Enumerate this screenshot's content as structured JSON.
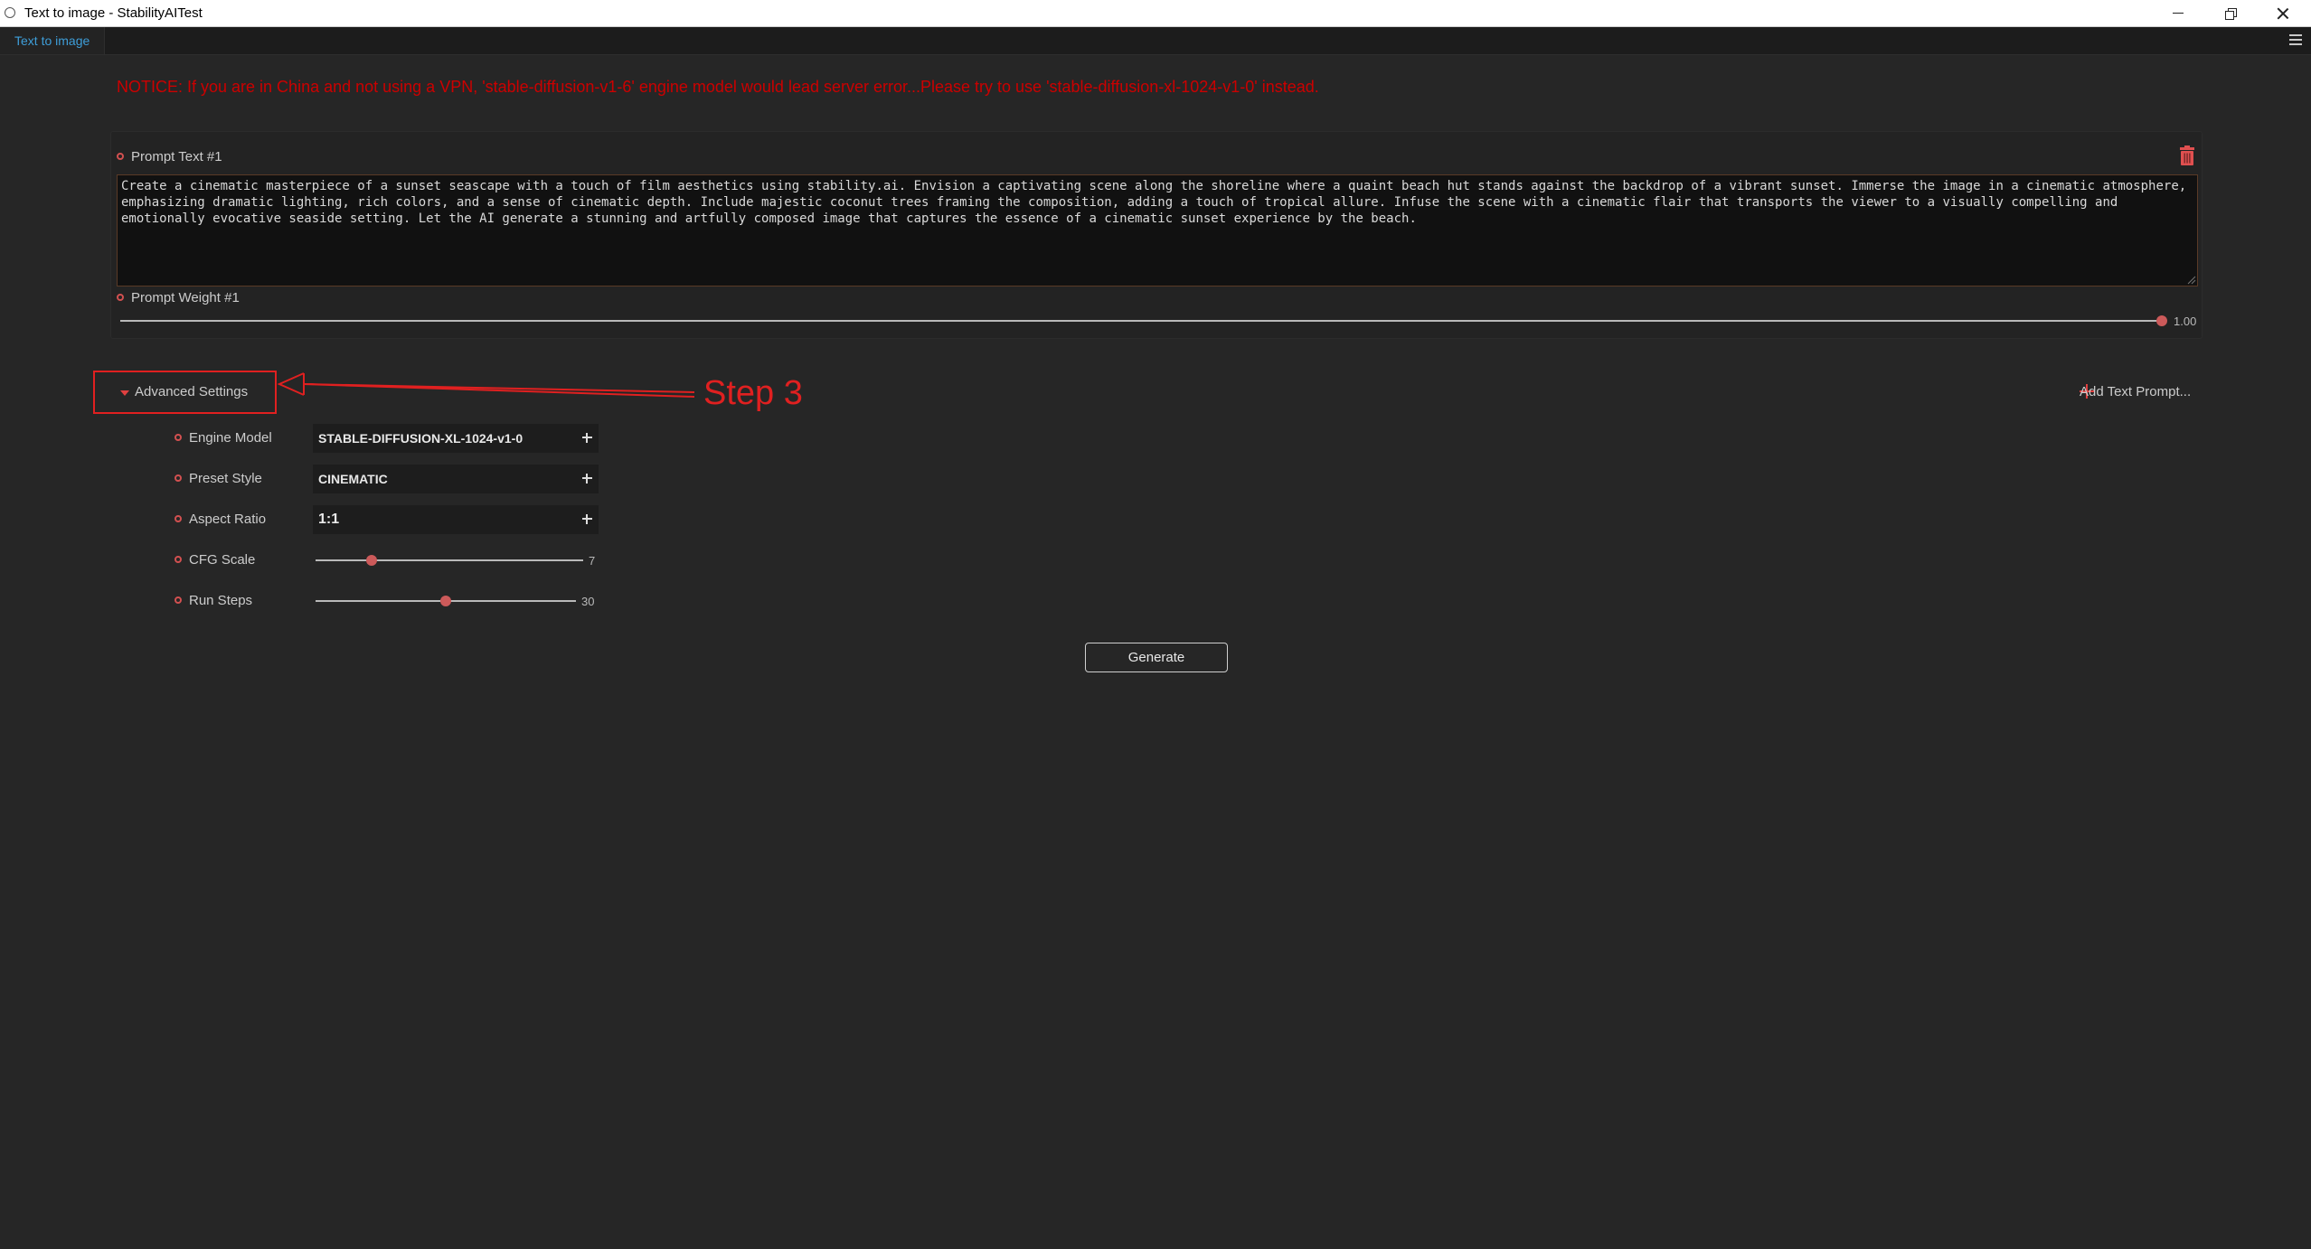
{
  "window": {
    "title": "Text to image - StabilityAITest"
  },
  "tabs": [
    {
      "label": "Text to image"
    }
  ],
  "notice": "NOTICE: If you are in China and not using a VPN, 'stable-diffusion-v1-6' engine model would lead server error...Please try to use 'stable-diffusion-xl-1024-v1-0' instead.",
  "prompt": {
    "text_label": "Prompt Text #1",
    "text": "Create a cinematic masterpiece of a sunset seascape with a touch of film aesthetics using stability.ai. Envision a captivating scene along the shoreline where a quaint beach hut stands against the backdrop of a vibrant sunset. Immerse the image in a cinematic atmosphere, emphasizing dramatic lighting, rich colors, and a sense of cinematic depth. Include majestic coconut trees framing the composition, adding a touch of tropical allure. Infuse the scene with a cinematic flair that transports the viewer to a visually compelling and emotionally evocative seaside setting. Let the AI generate a stunning and artfully composed image that captures the essence of a cinematic sunset experience by the beach.",
    "weight_label": "Prompt Weight #1",
    "weight_value": "1.00",
    "weight_fraction": 1.0
  },
  "advanced": {
    "toggle_label": "Advanced Settings",
    "annotation": "Step 3",
    "add_prompt_label": "Add Text Prompt...",
    "engine_label": "Engine Model",
    "engine_value": "STABLE-DIFFUSION-XL-1024-v1-0",
    "style_label": "Preset Style",
    "style_value": "CINEMATIC",
    "aspect_label": "Aspect Ratio",
    "aspect_value": "1:1",
    "cfg_label": "CFG Scale",
    "cfg_value": "7",
    "cfg_fraction": 0.21,
    "steps_label": "Run Steps",
    "steps_value": "30",
    "steps_fraction": 0.5
  },
  "generate_label": "Generate",
  "colors": {
    "background": "#262626",
    "accent": "#cc5a5a",
    "notice": "#cc0000",
    "annotation": "#e02020",
    "tab_text": "#3e9ed9"
  }
}
